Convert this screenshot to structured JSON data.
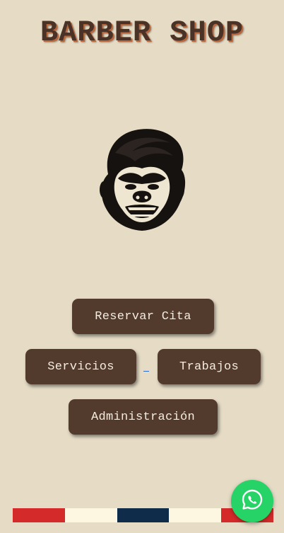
{
  "header": {
    "title": "BARBER SHOP"
  },
  "logo": {
    "icon": "gorilla-logo-icon"
  },
  "buttons": {
    "reservar": "Reservar Cita",
    "servicios": "Servicios",
    "trabajos": "Trabajos",
    "administracion": "Administración"
  },
  "footer": {
    "stripe_colors": [
      "#d42a2a",
      "#fdf6e0",
      "#0f2d4a",
      "#fdf6e0",
      "#d42a2a"
    ]
  },
  "whatsapp": {
    "icon": "whatsapp-icon",
    "color": "#25d366"
  },
  "theme": {
    "background": "#e6dcc6",
    "button": "#523a2d",
    "title": "#4a3226"
  }
}
